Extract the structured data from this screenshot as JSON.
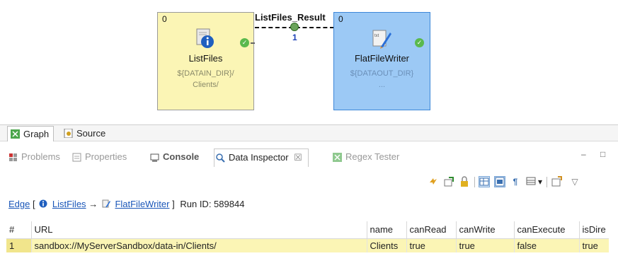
{
  "graph": {
    "nodes": [
      {
        "name": "ListFiles",
        "port": "0",
        "sub1": "${DATAIN_DIR}/",
        "sub2": "Clients/"
      },
      {
        "name": "FlatFileWriter",
        "port": "0",
        "sub1": "${DATAOUT_DIR}",
        "sub2": "..."
      }
    ],
    "edge": {
      "label": "ListFiles_Result",
      "count": "1"
    }
  },
  "editor_tabs": [
    "Graph",
    "Source"
  ],
  "view_tabs": [
    {
      "label": "Problems",
      "icon": "problems-icon"
    },
    {
      "label": "Properties",
      "icon": "properties-icon"
    },
    {
      "label": "Console",
      "icon": "console-icon"
    },
    {
      "label": "Data Inspector",
      "icon": "data-inspector-icon",
      "close": "☒"
    },
    {
      "label": "Regex Tester",
      "icon": "regex-icon"
    }
  ],
  "view_controls": {
    "minimize": "–",
    "maximize": "□"
  },
  "toolbar": {
    "icons": [
      "sync-icon",
      "export-icon",
      "lock-icon",
      "table-view-icon",
      "record-view-icon",
      "text-view-icon",
      "grid-menu-icon",
      "new-window-icon",
      "view-menu-icon"
    ],
    "glyphs": {
      "dropdown": "▾",
      "menu": "▽"
    }
  },
  "crumb": {
    "edge": "Edge",
    "open": "[",
    "from": "ListFiles",
    "arrow": "→",
    "to": "FlatFileWriter",
    "close": "]",
    "run": "Run ID: 589844"
  },
  "table": {
    "columns": [
      "#",
      "URL",
      "name",
      "canRead",
      "canWrite",
      "canExecute",
      "isDire"
    ],
    "rows": [
      [
        "1",
        "sandbox://MyServerSandbox/data-in/Clients/",
        "Clients",
        "true",
        "true",
        "false",
        "true"
      ]
    ]
  },
  "colors": {
    "listfiles_bg": "#fbf5b5",
    "writer_bg": "#9cc9f5",
    "ok": "#5ab94d",
    "link": "#1a56b8"
  }
}
